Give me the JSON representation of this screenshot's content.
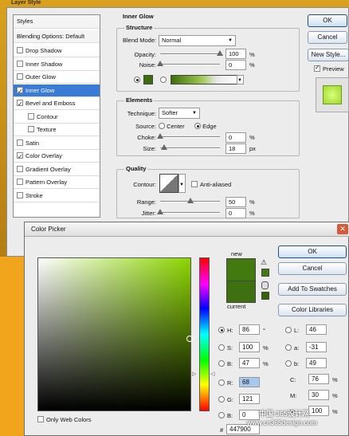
{
  "layer_style": {
    "window_title": "Layer Style",
    "styles_header": "Styles",
    "blending_options": "Blending Options: Default",
    "items": [
      {
        "label": "Drop Shadow",
        "checked": false,
        "indent": false
      },
      {
        "label": "Inner Shadow",
        "checked": false,
        "indent": false
      },
      {
        "label": "Outer Glow",
        "checked": false,
        "indent": false
      },
      {
        "label": "Inner Glow",
        "checked": true,
        "indent": false
      },
      {
        "label": "Bevel and Emboss",
        "checked": true,
        "indent": false
      },
      {
        "label": "Contour",
        "checked": false,
        "indent": true
      },
      {
        "label": "Texture",
        "checked": false,
        "indent": true
      },
      {
        "label": "Satin",
        "checked": false,
        "indent": false
      },
      {
        "label": "Color Overlay",
        "checked": true,
        "indent": false
      },
      {
        "label": "Gradient Overlay",
        "checked": false,
        "indent": false
      },
      {
        "label": "Pattern Overlay",
        "checked": false,
        "indent": false
      },
      {
        "label": "Stroke",
        "checked": false,
        "indent": false
      }
    ],
    "panel_title": "Inner Glow",
    "structure": {
      "title": "Structure",
      "blend_mode_label": "Blend Mode:",
      "blend_mode_value": "Normal",
      "opacity_label": "Opacity:",
      "opacity_value": "100",
      "opacity_unit": "%",
      "opacity_level": 1.0,
      "noise_label": "Noise:",
      "noise_value": "0",
      "noise_unit": "%",
      "noise_level": 0.0
    },
    "elements": {
      "title": "Elements",
      "technique_label": "Technique:",
      "technique_value": "Softer",
      "source_label": "Source:",
      "source_center": "Center",
      "source_edge": "Edge",
      "choke_label": "Choke:",
      "choke_value": "0",
      "choke_unit": "%",
      "choke_level": 0.0,
      "size_label": "Size:",
      "size_value": "18",
      "size_unit": "px",
      "size_level": 0.07
    },
    "quality": {
      "title": "Quality",
      "contour_label": "Contour:",
      "anti_aliased": "Anti-aliased",
      "range_label": "Range:",
      "range_value": "50",
      "range_unit": "%",
      "range_level": 0.5,
      "jitter_label": "Jitter:",
      "jitter_value": "0",
      "jitter_unit": "%",
      "jitter_level": 0.0
    },
    "buttons": {
      "ok": "OK",
      "cancel": "Cancel",
      "new_style": "New Style...",
      "preview": "Preview"
    },
    "glow_color": "#3e6e0a"
  },
  "color_picker": {
    "title": "Color Picker",
    "new_label": "new",
    "current_label": "current",
    "new_color": "#437a10",
    "current_color": "#3f7010",
    "buttons": {
      "ok": "OK",
      "cancel": "Cancel",
      "add_swatches": "Add To Swatches",
      "libraries": "Color Libraries"
    },
    "only_web_colors": "Only Web Colors",
    "fields": {
      "H": {
        "label": "H:",
        "value": "86",
        "unit": "°",
        "selected": true
      },
      "S": {
        "label": "S:",
        "value": "100",
        "unit": "%",
        "selected": false
      },
      "B": {
        "label": "B:",
        "value": "47",
        "unit": "%",
        "selected": false
      },
      "R": {
        "label": "R:",
        "value": "68",
        "unit": "",
        "selected": false
      },
      "G": {
        "label": "G:",
        "value": "121",
        "unit": "",
        "selected": false
      },
      "Bl": {
        "label": "B:",
        "value": "0",
        "unit": "",
        "selected": false
      },
      "L": {
        "label": "L:",
        "value": "46",
        "unit": "",
        "selected": false
      },
      "a": {
        "label": "a:",
        "value": "-31",
        "unit": "",
        "selected": false
      },
      "b": {
        "label": "b:",
        "value": "49",
        "unit": "",
        "selected": false
      },
      "C": {
        "label": "C:",
        "value": "76",
        "unit": "%"
      },
      "M": {
        "label": "M:",
        "value": "30",
        "unit": "%"
      },
      "Y": {
        "label": "Y:",
        "value": "100",
        "unit": "%"
      },
      "hex": {
        "label": "#",
        "value": "447900"
      }
    }
  },
  "watermark": {
    "line1": "中国·365设计网",
    "line2": "www.cn365design.com"
  }
}
